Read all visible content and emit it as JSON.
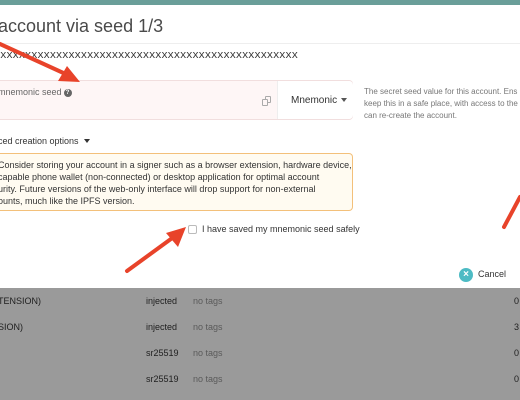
{
  "modal": {
    "title": "account via seed 1/3",
    "address": "xxxxxxxxxxxxxxxxxxxxxxxxxxxxxxxxxxxxxxxxxxxxxxxx",
    "seed_field": {
      "label": "mnemonic seed",
      "value": "",
      "type_selected": "Mnemonic"
    },
    "help_lines": [
      "The secret seed value for this account. Ens",
      "keep this in a safe place, with access to the",
      "can re-create the account."
    ],
    "advanced_label": "ced creation options",
    "warning_lines": [
      "Consider storing your account in a signer such as a browser extension, hardware device,",
      "capable phone wallet (non-connected) or desktop application for optimal account",
      "urity. Future versions of the web-only interface will drop support for non-external",
      "ounts, much like the IPFS version."
    ],
    "checkbox_label": "I have saved my mnemonic seed safely",
    "checkbox_checked": false,
    "cancel_label": "Cancel"
  },
  "background_table": {
    "rows": [
      {
        "name": "TENSION)",
        "type": "injected",
        "tags": "no tags",
        "balance": "0"
      },
      {
        "name": "SION)",
        "type": "injected",
        "tags": "no tags",
        "balance": "3"
      },
      {
        "name": "",
        "type": "sr25519",
        "tags": "no tags",
        "balance": "0"
      },
      {
        "name": "",
        "type": "sr25519",
        "tags": "no tags",
        "balance": "0"
      }
    ]
  },
  "colors": {
    "accent": "#4dbbc4",
    "arrow": "#e8432a",
    "warning_border": "#f3c07a",
    "top_bar": "#6a9e99"
  }
}
